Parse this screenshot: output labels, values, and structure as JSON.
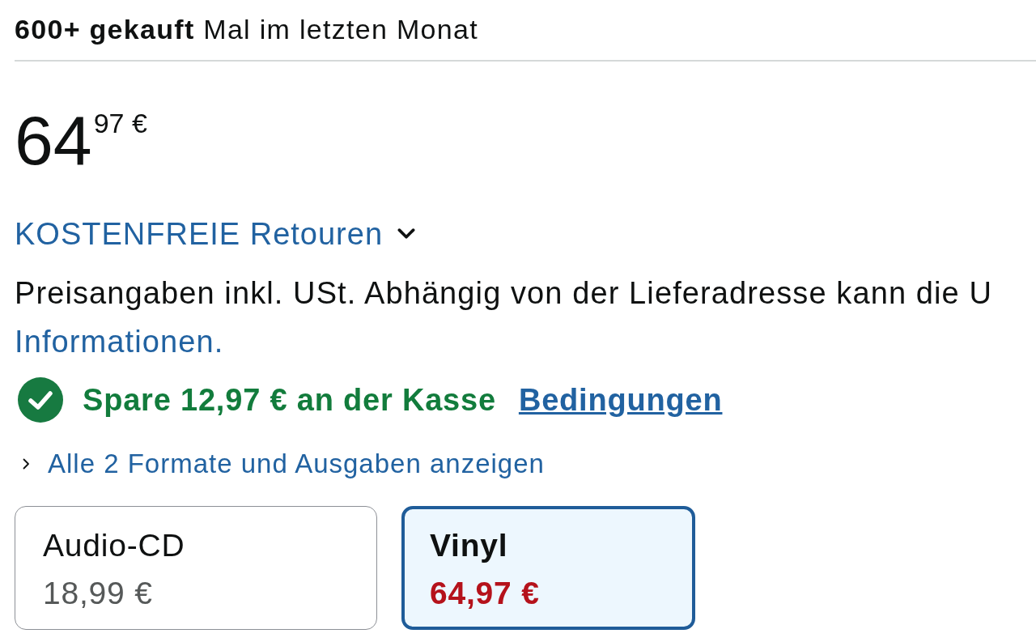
{
  "purchase_note": "**600+ gekauft** Mal im letzten Monat",
  "price": {
    "whole": "64",
    "fraction": "97",
    "currency": "€"
  },
  "returns": {
    "label": "KOSTENFREIE Retouren",
    "expanded": false
  },
  "tax_note": "Preisangaben inkl. USt. Abhängig von der Lieferadresse kann die U",
  "info_link": "Informationen.",
  "coupon": {
    "text": "Spare 12,97 € an der Kasse",
    "link": "Bedingungen"
  },
  "formats_link": "Alle 2 Formate und Ausgaben anzeigen",
  "formats": [
    {
      "name": "Audio-CD",
      "price": "18,99 €",
      "selected": false
    },
    {
      "name": "Vinyl",
      "price": "64,97 €",
      "selected": true
    }
  ]
}
